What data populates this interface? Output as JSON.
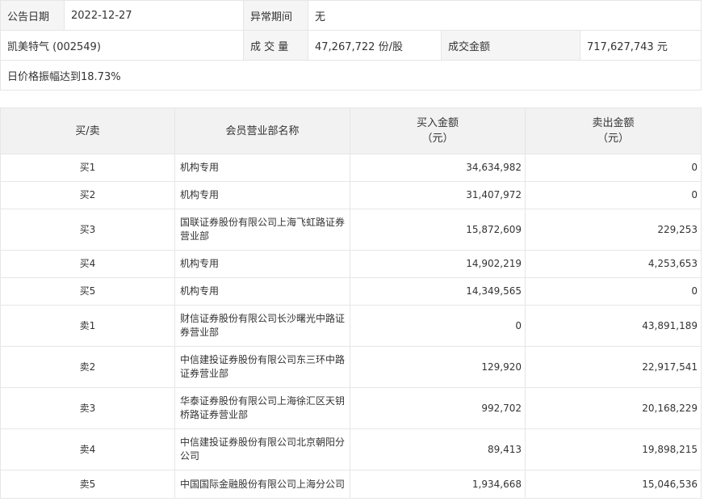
{
  "info": {
    "date_label": "公告日期",
    "date_value": "2022-12-27",
    "abnormal_label": "异常期间",
    "abnormal_value": "无",
    "stock_name": "凯美特气 (002549)",
    "volume_label": "成 交 量",
    "volume_value": "47,267,722 份/股",
    "amount_label": "成交金额",
    "amount_value": "717,627,743 元",
    "reason": "日价格振幅达到18.73%"
  },
  "table": {
    "headers": {
      "side": "买/卖",
      "branch": "会员营业部名称",
      "buy_line1": "买入金额",
      "buy_line2": "（元）",
      "sell_line1": "卖出金额",
      "sell_line2": "（元）"
    },
    "rows": [
      {
        "side": "买1",
        "branch": "机构专用",
        "buy": "34,634,982",
        "sell": "0"
      },
      {
        "side": "买2",
        "branch": "机构专用",
        "buy": "31,407,972",
        "sell": "0"
      },
      {
        "side": "买3",
        "branch": "国联证券股份有限公司上海飞虹路证券营业部",
        "buy": "15,872,609",
        "sell": "229,253"
      },
      {
        "side": "买4",
        "branch": "机构专用",
        "buy": "14,902,219",
        "sell": "4,253,653"
      },
      {
        "side": "买5",
        "branch": "机构专用",
        "buy": "14,349,565",
        "sell": "0"
      },
      {
        "side": "卖1",
        "branch": "财信证券股份有限公司长沙曙光中路证券营业部",
        "buy": "0",
        "sell": "43,891,189"
      },
      {
        "side": "卖2",
        "branch": "中信建投证券股份有限公司东三环中路证券营业部",
        "buy": "129,920",
        "sell": "22,917,541"
      },
      {
        "side": "卖3",
        "branch": "华泰证券股份有限公司上海徐汇区天钥桥路证券营业部",
        "buy": "992,702",
        "sell": "20,168,229"
      },
      {
        "side": "卖4",
        "branch": "中信建投证券股份有限公司北京朝阳分公司",
        "buy": "89,413",
        "sell": "19,898,215"
      },
      {
        "side": "卖5",
        "branch": "中国国际金融股份有限公司上海分公司",
        "buy": "1,934,668",
        "sell": "15,046,536"
      }
    ]
  }
}
